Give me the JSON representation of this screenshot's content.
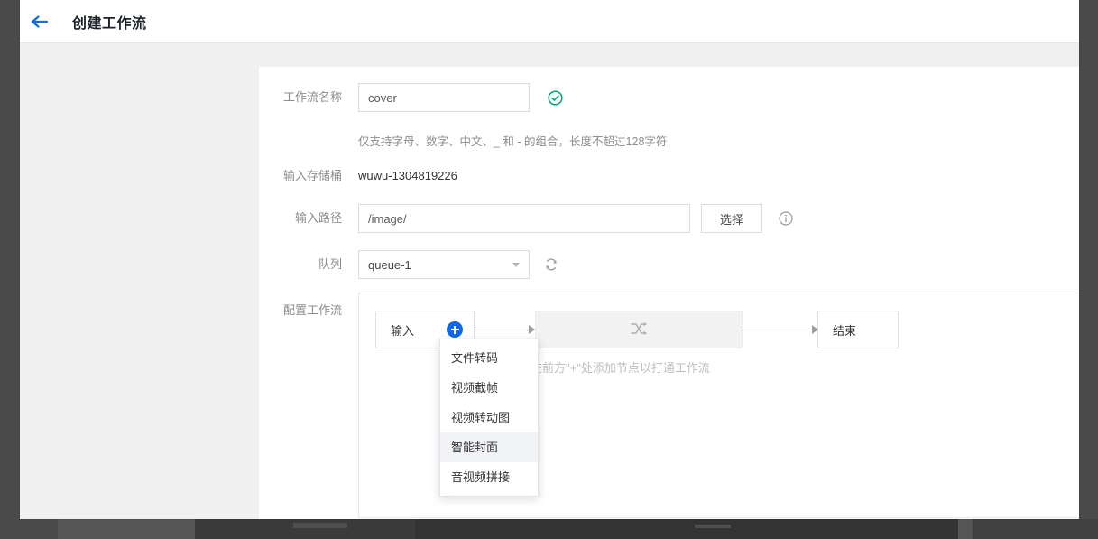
{
  "header": {
    "back_icon": "arrow-left-icon",
    "title": "创建工作流"
  },
  "form": {
    "workflow_name": {
      "label": "工作流名称",
      "value": "cover",
      "placeholder": "",
      "status_icon": "check-circle-icon",
      "helper_text": "仅支持字母、数字、中文、_ 和 - 的组合，长度不超过128字符"
    },
    "input_bucket": {
      "label": "输入存储桶",
      "value": "wuwu-1304819226"
    },
    "input_path": {
      "label": "输入路径",
      "value": "/image/",
      "placeholder": "",
      "select_button": "选择",
      "info_icon": "info-circle-icon"
    },
    "queue": {
      "label": "队列",
      "value": "queue-1",
      "caret_icon": "chevron-down-icon",
      "refresh_icon": "refresh-icon"
    },
    "configure_workflow": {
      "label": "配置工作流"
    }
  },
  "workflow": {
    "nodes": [
      {
        "id": "input",
        "label": "输入"
      },
      {
        "id": "placeholder",
        "label": "",
        "icon": "shuffle-icon"
      },
      {
        "id": "end",
        "label": "结束"
      }
    ],
    "add_button_icon": "plus-circle-icon",
    "hint": "在前方\"+\"处添加节点以打通工作流"
  },
  "node_type_menu": {
    "items": [
      {
        "label": "文件转码",
        "selected": false
      },
      {
        "label": "视频截帧",
        "selected": false
      },
      {
        "label": "视频转动图",
        "selected": false
      },
      {
        "label": "智能封面",
        "selected": true
      },
      {
        "label": "音视频拼接",
        "selected": false
      }
    ]
  },
  "colors": {
    "accent_blue": "#1168e3",
    "success_green": "#00a870",
    "label_gray": "#8c8c8c",
    "menu_highlight": "#f1f3f6"
  }
}
